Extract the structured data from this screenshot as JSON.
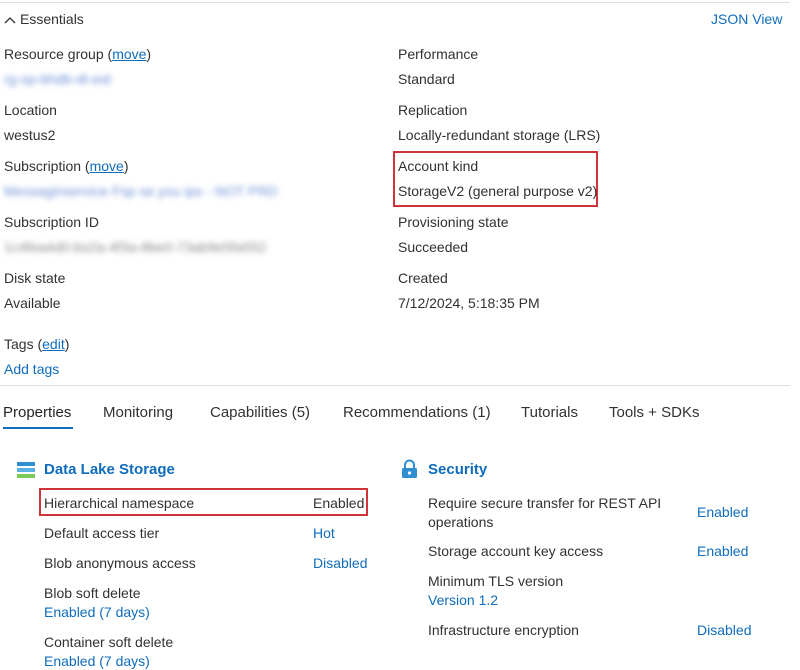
{
  "essentials": {
    "title": "Essentials",
    "json_view": "JSON View",
    "left": [
      {
        "label": "Resource group",
        "action": "move",
        "value": "rg-sp-bhdb-dl-eid",
        "blurred": true
      },
      {
        "label": "Location",
        "value": "westus2"
      },
      {
        "label": "Subscription",
        "action": "move",
        "value": "Messaginservice Fsp se.you ips - NOT PRD",
        "blurred": true
      },
      {
        "label": "Subscription ID",
        "value": "1c4fea4d0-bs2a-4f3a-8be0-73ab9e5fa552",
        "blurred": true
      },
      {
        "label": "Disk state",
        "value": "Available"
      }
    ],
    "right": [
      {
        "label": "Performance",
        "value": "Standard"
      },
      {
        "label": "Replication",
        "value": "Locally-redundant storage (LRS)"
      },
      {
        "label": "Account kind",
        "value": "StorageV2 (general purpose v2)"
      },
      {
        "label": "Provisioning state",
        "value": "Succeeded"
      },
      {
        "label": "Created",
        "value": "7/12/2024, 5:18:35 PM"
      }
    ],
    "tags_label": "Tags",
    "tags_action": "edit",
    "add_tags": "Add tags"
  },
  "tabs": [
    "Properties",
    "Monitoring",
    "Capabilities (5)",
    "Recommendations (1)",
    "Tutorials",
    "Tools + SDKs"
  ],
  "data_lake": {
    "title": "Data Lake Storage",
    "rows": [
      {
        "label": "Hierarchical namespace",
        "value": "Enabled"
      },
      {
        "label": "Default access tier",
        "value": "Hot"
      },
      {
        "label": "Blob anonymous access",
        "value": "Disabled"
      },
      {
        "label": "Blob soft delete",
        "value": "Enabled (7 days)"
      },
      {
        "label": "Container soft delete",
        "value": "Enabled (7 days)"
      }
    ]
  },
  "security": {
    "title": "Security",
    "rows": [
      {
        "label": "Require secure transfer for REST API",
        "label2": "operations",
        "value": "Enabled"
      },
      {
        "label": "Storage account key access",
        "value": "Enabled"
      },
      {
        "label": "Minimum TLS version",
        "value": "Version 1.2"
      },
      {
        "label": "Infrastructure encryption",
        "value": "Disabled"
      }
    ]
  },
  "colors": {
    "accent": "#0f6cbd",
    "highlight": "#d13438",
    "text": "#323130"
  }
}
